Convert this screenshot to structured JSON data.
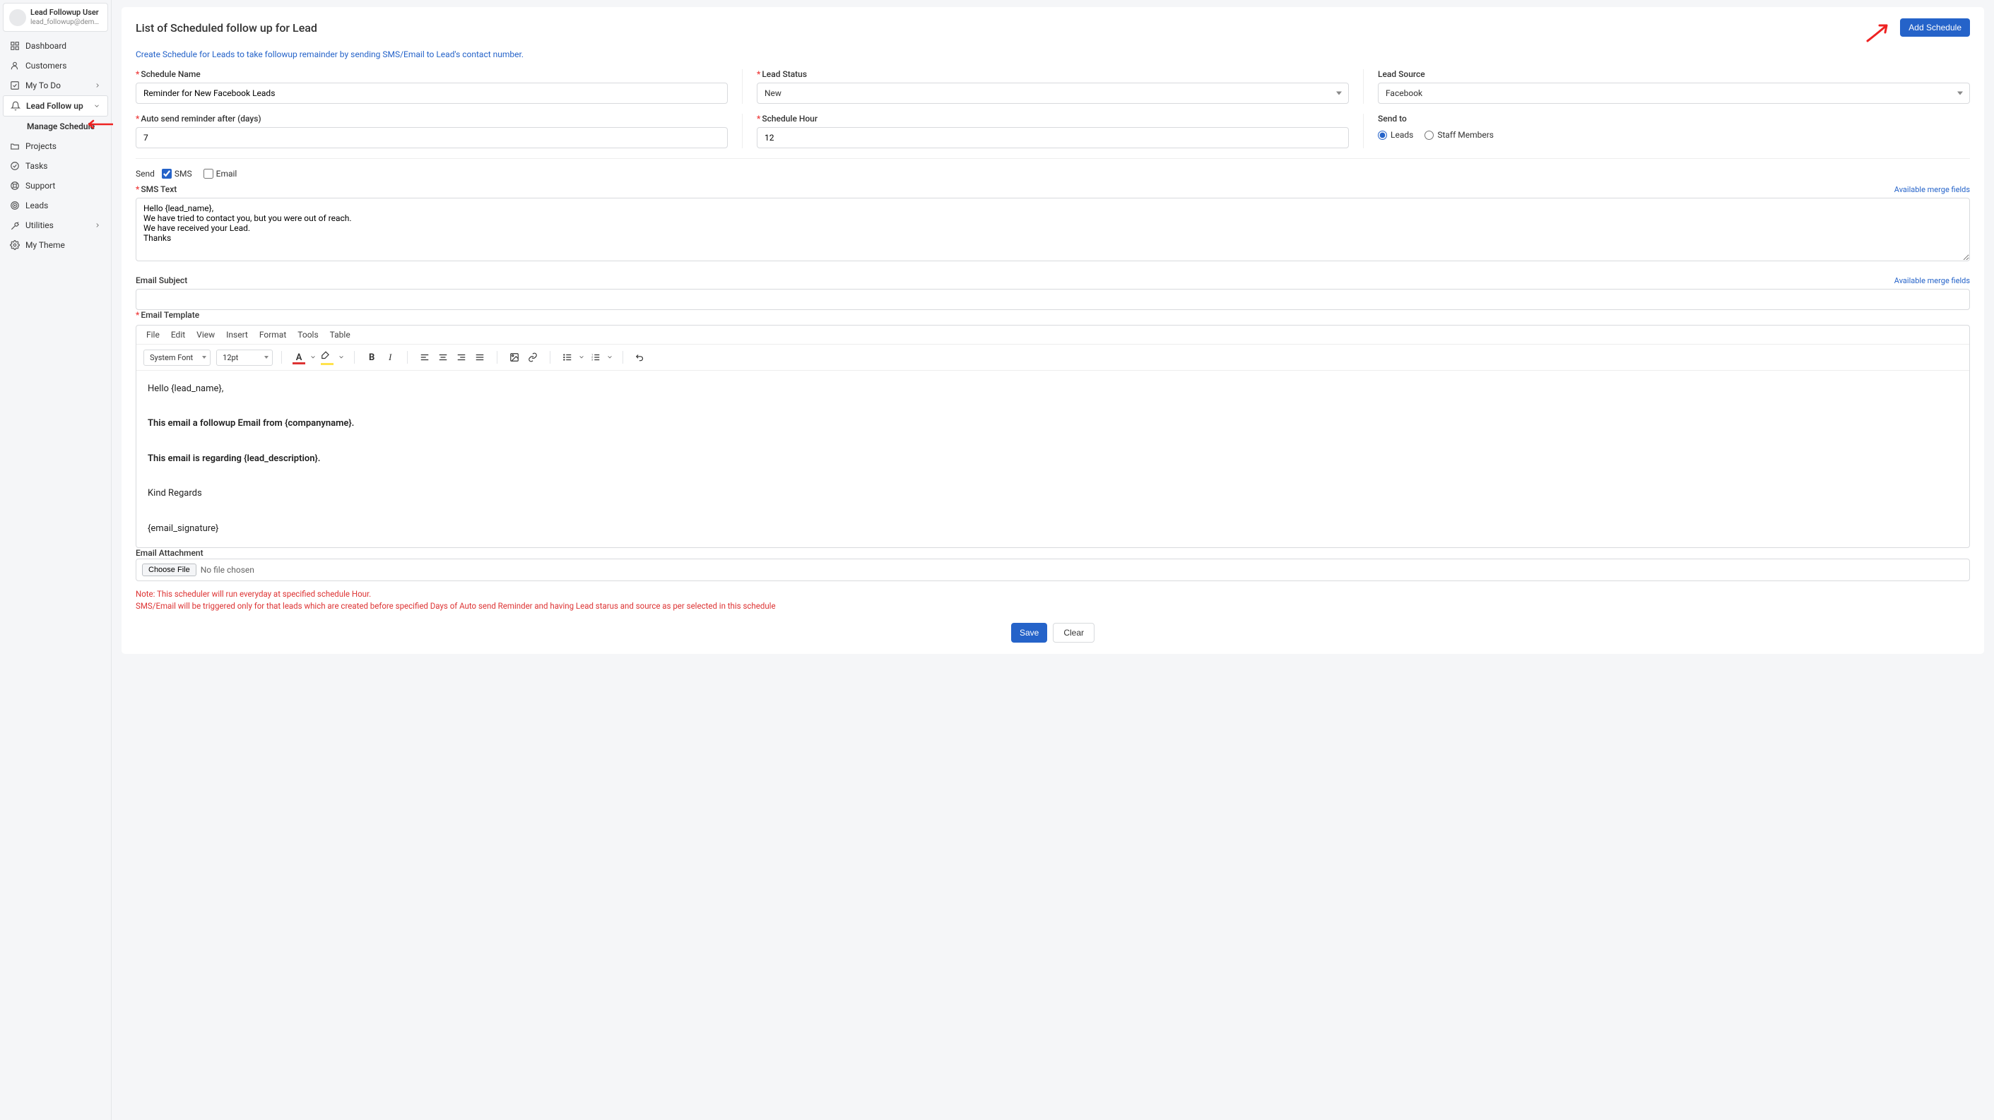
{
  "user": {
    "name": "Lead Followup User",
    "email": "lead_followup@demo..."
  },
  "sidebar": {
    "items": [
      {
        "icon": "dashboard",
        "label": "Dashboard"
      },
      {
        "icon": "user",
        "label": "Customers"
      },
      {
        "icon": "checkbox",
        "label": "My To Do",
        "chev": "right"
      },
      {
        "icon": "bell",
        "label": "Lead Follow up",
        "chev": "down",
        "active": true
      },
      {
        "icon": "folder",
        "label": "Projects"
      },
      {
        "icon": "check-circle",
        "label": "Tasks"
      },
      {
        "icon": "life-ring",
        "label": "Support"
      },
      {
        "icon": "target",
        "label": "Leads"
      },
      {
        "icon": "wrench",
        "label": "Utilities",
        "chev": "right"
      },
      {
        "icon": "gear",
        "label": "My Theme"
      }
    ],
    "sub_item": "Manage Schedule"
  },
  "page": {
    "title": "List of Scheduled follow up for Lead",
    "add_btn": "Add Schedule",
    "help": "Create Schedule for Leads to take followup remainder by sending SMS/Email to Lead's contact number."
  },
  "form": {
    "schedule_name": {
      "label": "Schedule Name",
      "value": "Reminder for New Facebook Leads",
      "required": true
    },
    "lead_status": {
      "label": "Lead Status",
      "value": "New",
      "required": true
    },
    "lead_source": {
      "label": "Lead Source",
      "value": "Facebook",
      "required": false
    },
    "auto_send_days": {
      "label": "Auto send reminder after (days)",
      "value": "7",
      "required": true
    },
    "schedule_hour": {
      "label": "Schedule Hour",
      "value": "12",
      "required": true
    },
    "send_to": {
      "label": "Send to",
      "options": [
        "Leads",
        "Staff Members"
      ],
      "selected": "Leads"
    },
    "send_label": "Send",
    "send_sms": {
      "label": "SMS",
      "checked": true
    },
    "send_email": {
      "label": "Email",
      "checked": false
    },
    "sms_text": {
      "label": "SMS Text",
      "value": "Hello {lead_name},\nWe have tried to contact you, but you were out of reach.\nWe have received your Lead.\nThanks",
      "required": true
    },
    "email_subject": {
      "label": "Email Subject",
      "value": ""
    },
    "merge_link": "Available merge fields",
    "email_template": {
      "label": "Email Template",
      "menubar": [
        "File",
        "Edit",
        "View",
        "Insert",
        "Format",
        "Tools",
        "Table"
      ],
      "font_family": "System Font",
      "font_size": "12pt",
      "body": {
        "line1": "Hello {lead_name},",
        "line2": "This email a followup Email from {companyname}.",
        "line3": "This email is regarding {lead_description}.",
        "line4": "Kind Regards",
        "line5": "{email_signature}"
      }
    },
    "attachment": {
      "label": "Email Attachment",
      "btn": "Choose File",
      "status": "No file chosen"
    },
    "note": {
      "line1": "Note: This scheduler will run everyday at specified schedule Hour.",
      "line2": "SMS/Email will be triggered only for that leads which are created before specified Days of Auto send Reminder and having Lead starus and source as per selected in this schedule"
    },
    "save_btn": "Save",
    "clear_btn": "Clear"
  }
}
